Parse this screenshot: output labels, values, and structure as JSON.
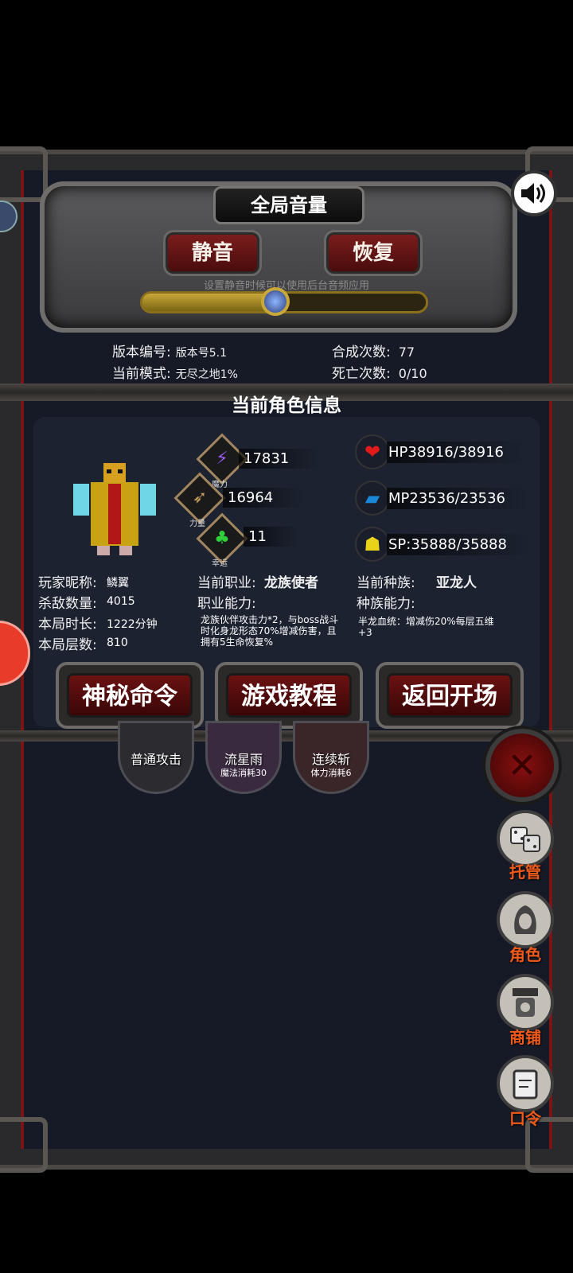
{
  "volume": {
    "title": "全局音量",
    "mute_label": "静音",
    "restore_label": "恢复",
    "hint": "设置静音时候可以使用后台音频应用",
    "level_fraction": 0.47
  },
  "game_info": {
    "version_label": "版本编号:",
    "version_value": "版本号5.1",
    "mode_label": "当前模式:",
    "mode_value": "无尽之地1%",
    "merge_label": "合成次数:",
    "merge_value": "77",
    "death_label": "死亡次数:",
    "death_value": "0/10"
  },
  "character": {
    "section_title": "当前角色信息",
    "magic_value": "17831",
    "magic_label": "魔力",
    "strength_value": "16964",
    "strength_label": "力量",
    "luck_value": "11",
    "luck_label": "幸运",
    "hp": "HP38916/38916",
    "mp": "MP23536/23536",
    "sp": "SP:35888/35888",
    "nickname_label": "玩家昵称:",
    "nickname_value": "鳞翼",
    "kills_label": "杀敌数量:",
    "kills_value": "4015",
    "duration_label": "本局时长:",
    "duration_value": "1222分钟",
    "floor_label": "本局层数:",
    "floor_value": "810",
    "job_label": "当前职业:",
    "job_value": "龙族使者",
    "job_ability_label": "职业能力:",
    "job_ability_text": "龙族伙伴攻击力*2，与boss战斗时化身龙形态70%增减伤害，且拥有5生命恢复%",
    "race_label": "当前种族:",
    "race_value": "亚龙人",
    "race_ability_label": "种族能力:",
    "race_ability_text": "半龙血统：增减伤20%每层五维+3"
  },
  "actions": {
    "secret_label": "神秘命令",
    "tutorial_label": "游戏教程",
    "return_label": "返回开场"
  },
  "skills": [
    {
      "name": "普通攻击",
      "cost": ""
    },
    {
      "name": "流星雨",
      "cost": "魔法消耗30"
    },
    {
      "name": "连续斩",
      "cost": "体力消耗6"
    }
  ],
  "side_menu": {
    "auto_label": "托管",
    "role_label": "角色",
    "shop_label": "商铺",
    "code_label": "口令"
  },
  "colors": {
    "accent_red": "#6a1212",
    "side_label": "#f05a1a",
    "gold": "#c9a83a"
  }
}
